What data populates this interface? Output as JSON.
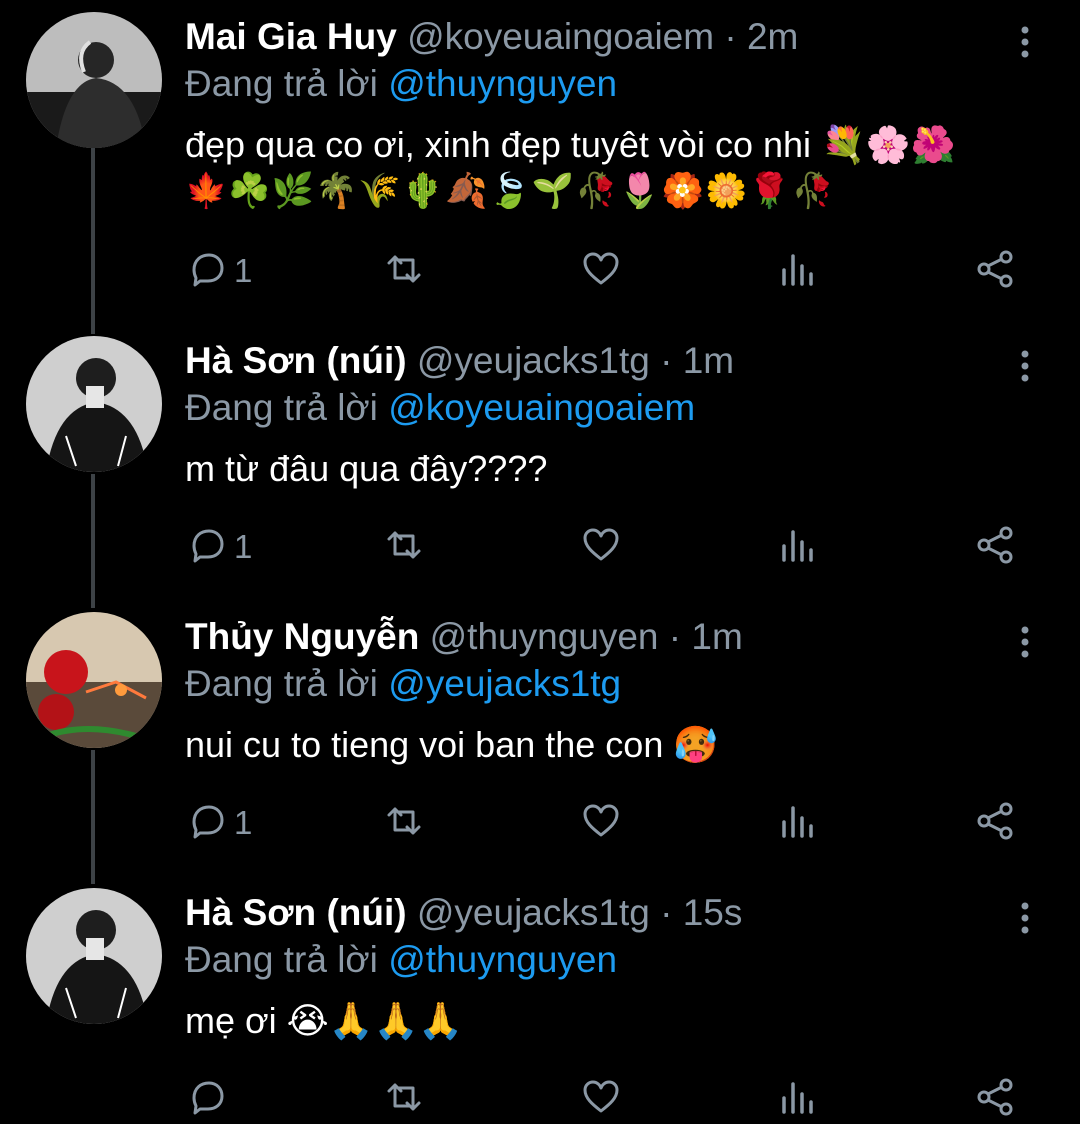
{
  "tweets": [
    {
      "name": "Mai Gia Huy",
      "handle": "@koyeuaingoaiem",
      "separator": "·",
      "time": "2m",
      "replying_prefix": "Đang trả lời",
      "replying_to": "@thuynguyen",
      "text": "đẹp qua co ơi, xinh đẹp tuyêt vòi co nhi 💐🌸🌺",
      "text_line2": "🍁☘️🌿🌴🌾🌵🍂🍃🌱🥀🌷🏵️🌼🌹🥀",
      "reply_count": "1"
    },
    {
      "name": "Hà Sơn (núi)",
      "handle": "@yeujacks1tg",
      "separator": "·",
      "time": "1m",
      "replying_prefix": "Đang trả lời",
      "replying_to": "@koyeuaingoaiem",
      "text": "m từ đâu qua đây????",
      "reply_count": "1"
    },
    {
      "name": "Thủy Nguyễn",
      "handle": "@thuynguyen",
      "separator": "·",
      "time": "1m",
      "replying_prefix": "Đang trả lời",
      "replying_to": "@yeujacks1tg",
      "text": "nui cu to tieng voi ban the con 🥵",
      "reply_count": "1"
    },
    {
      "name": "Hà Sơn (núi)",
      "handle": "@yeujacks1tg",
      "separator": "·",
      "time": "15s",
      "replying_prefix": "Đang trả lời",
      "replying_to": "@thuynguyen",
      "text": "mẹ ơi 😭🙏🙏🙏",
      "reply_count": ""
    }
  ],
  "icons": {
    "reply": "reply-icon",
    "retweet": "retweet-icon",
    "like": "heart-icon",
    "views": "analytics-icon",
    "share": "share-icon",
    "more": "more-vertical-icon"
  },
  "colors": {
    "background": "#000000",
    "text": "#ffffff",
    "muted": "#8b98a5",
    "link": "#1d9bf0",
    "thread_line": "#3d4246"
  }
}
